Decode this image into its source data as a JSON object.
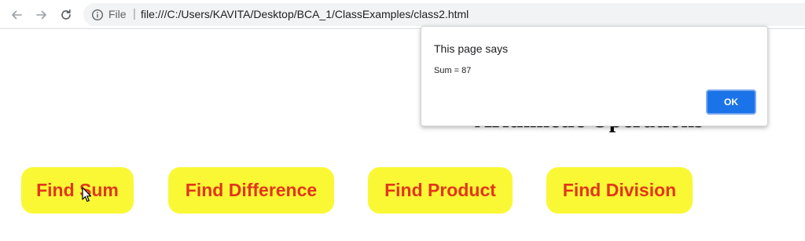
{
  "browser": {
    "back_icon": "arrow-left-icon",
    "forward_icon": "arrow-right-icon",
    "reload_icon": "reload-icon",
    "info_icon": "info-icon",
    "scheme_label": "File",
    "separator": "|",
    "url": "file:///C:/Users/KAVITA/Desktop/BCA_1/ClassExamples/class2.html"
  },
  "page": {
    "heading": "Arithmetic Operations",
    "buttons": [
      {
        "label": "Find Sum"
      },
      {
        "label": "Find Difference"
      },
      {
        "label": "Find Product"
      },
      {
        "label": "Find Division"
      }
    ],
    "button_color": "#faf834",
    "button_text_color": "#e2361a"
  },
  "dialog": {
    "title": "This page says",
    "message": "Sum = 87",
    "ok_label": "OK",
    "ok_color": "#1a73e8"
  }
}
